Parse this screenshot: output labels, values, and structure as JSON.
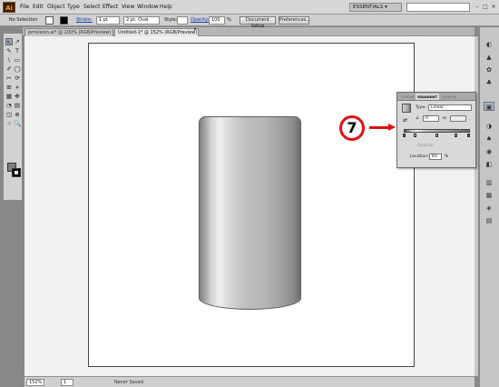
{
  "app": {
    "logo_text": "Ai"
  },
  "menu": [
    "File",
    "Edit",
    "Object",
    "Type",
    "Select",
    "Effect",
    "View",
    "Window",
    "Help"
  ],
  "workspace": {
    "label": "ESSENTIALS ▾"
  },
  "window_buttons": [
    "–",
    "□",
    "✕"
  ],
  "control_bar": {
    "selection": "No Selection",
    "stroke_label": "Stroke:",
    "stroke_value": "1 pt",
    "brush_value": "2 pt. Oval",
    "style_label": "Style:",
    "opacity_label": "Opacity:",
    "opacity_value": "100",
    "opacity_unit": "%",
    "doc_setup": "Document Setup",
    "preferences": "Preferences..."
  },
  "tabs": [
    {
      "label": "prnvision.ai* @ 100% (RGB/Preview)",
      "active": false
    },
    {
      "label": "Untitled-1* @ 152% (RGB/Preview)",
      "active": true
    }
  ],
  "tab_close_glyph": "✕",
  "tools": {
    "glyphs": [
      "↖",
      "↗",
      "✎",
      "T",
      "\\",
      "▭",
      "✐",
      "◯",
      "✂",
      "⟳",
      "⊞",
      "⋄",
      "▦",
      "✥",
      "◔",
      "▤",
      "◫",
      "⊕",
      "☝",
      "🔍"
    ]
  },
  "status": {
    "zoom": "152%",
    "page": "1",
    "saved_state": "Never Saved"
  },
  "gradient_panel": {
    "tabs": [
      "STROKE",
      "GRADIENT",
      "TRANSPA"
    ],
    "type_label": "Type:",
    "type_value": "Linear",
    "angle_value": "0",
    "aspect_value": "",
    "opacity_label": "Opacity:",
    "location_label": "Location:",
    "location_value": "83",
    "percent": "%"
  },
  "callout": {
    "number": "7"
  },
  "dock_icons": [
    "◐",
    "▲",
    "✿",
    "♣",
    "▣",
    "◑",
    "♠",
    "◉",
    "◧",
    "▥",
    "▦",
    "◈",
    "▤"
  ]
}
